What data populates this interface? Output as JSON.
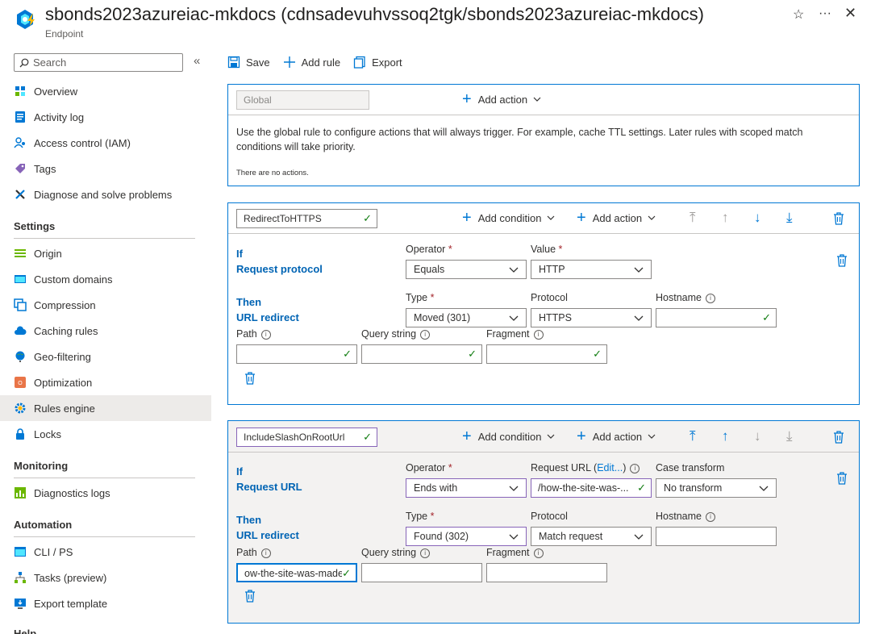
{
  "header": {
    "title": "sbonds2023azureiac-mkdocs (cdnsadevuhvssoq2tgk/sbonds2023azureiac-mkdocs)",
    "subtitle": "Endpoint"
  },
  "sidebar": {
    "search_placeholder": "Search",
    "items_top": [
      {
        "label": "Overview",
        "icon": "overview-icon"
      },
      {
        "label": "Activity log",
        "icon": "activity-log-icon"
      },
      {
        "label": "Access control (IAM)",
        "icon": "iam-icon"
      },
      {
        "label": "Tags",
        "icon": "tag-icon"
      },
      {
        "label": "Diagnose and solve problems",
        "icon": "wrench-icon"
      }
    ],
    "settings_header": "Settings",
    "settings_items": [
      {
        "label": "Origin",
        "icon": "origin-icon"
      },
      {
        "label": "Custom domains",
        "icon": "custom-domains-icon"
      },
      {
        "label": "Compression",
        "icon": "compression-icon"
      },
      {
        "label": "Caching rules",
        "icon": "cloud-icon"
      },
      {
        "label": "Geo-filtering",
        "icon": "globe-icon"
      },
      {
        "label": "Optimization",
        "icon": "optimization-icon"
      },
      {
        "label": "Rules engine",
        "icon": "gear-icon"
      },
      {
        "label": "Locks",
        "icon": "lock-icon"
      }
    ],
    "monitoring_header": "Monitoring",
    "monitoring_items": [
      {
        "label": "Diagnostics logs",
        "icon": "diagnostics-icon"
      }
    ],
    "automation_header": "Automation",
    "automation_items": [
      {
        "label": "CLI / PS",
        "icon": "cli-icon"
      },
      {
        "label": "Tasks (preview)",
        "icon": "tasks-icon"
      },
      {
        "label": "Export template",
        "icon": "export-template-icon"
      }
    ],
    "help_header": "Help"
  },
  "toolbar": {
    "save": "Save",
    "add_rule": "Add rule",
    "export": "Export"
  },
  "global_rule": {
    "name": "Global",
    "add_action": "Add action",
    "description": "Use the global rule to configure actions that will always trigger. For example, cache TTL settings. Later rules with scoped match conditions will take priority.",
    "no_actions": "There are no actions."
  },
  "rule1": {
    "name": "RedirectToHTTPS",
    "add_condition": "Add condition",
    "add_action": "Add action",
    "if_label": "If",
    "condition_label": "Request protocol",
    "operator_label": "Operator",
    "operator_value": "Equals",
    "value_label": "Value",
    "value_value": "HTTP",
    "then_label": "Then",
    "action_label": "URL redirect",
    "type_label": "Type",
    "type_value": "Moved (301)",
    "protocol_label": "Protocol",
    "protocol_value": "HTTPS",
    "hostname_label": "Hostname",
    "path_label": "Path",
    "query_label": "Query string",
    "fragment_label": "Fragment"
  },
  "rule2": {
    "name": "IncludeSlashOnRootUrl",
    "add_condition": "Add condition",
    "add_action": "Add action",
    "if_label": "If",
    "condition_label": "Request URL",
    "operator_label": "Operator",
    "operator_value": "Ends with",
    "requrl_label": "Request URL",
    "edit_link": "Edit...",
    "requrl_value": "/how-the-site-was-...",
    "case_label": "Case transform",
    "case_value": "No transform",
    "then_label": "Then",
    "action_label": "URL redirect",
    "type_label": "Type",
    "type_value": "Found (302)",
    "protocol_label": "Protocol",
    "protocol_value": "Match request",
    "hostname_label": "Hostname",
    "path_label": "Path",
    "path_value": "ow-the-site-was-made",
    "query_label": "Query string",
    "fragment_label": "Fragment"
  }
}
